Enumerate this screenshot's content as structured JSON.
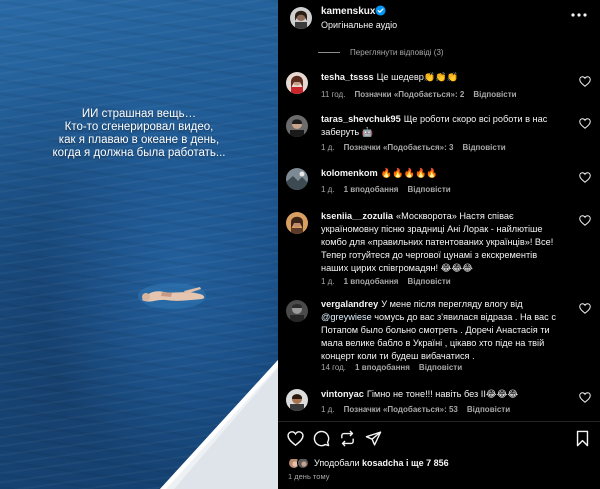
{
  "media": {
    "caption": "ИИ страшная вещь…\nКто-то сгенерировал видео,\nкак я плаваю в океане в день,\nкогда я должна была работать..."
  },
  "header": {
    "username": "kamenskux",
    "audio": "Оригінальне аудіо",
    "more_icon": "more-horizontal-icon"
  },
  "replies_toggle": "Переглянути відповіді (3)",
  "comments": [
    {
      "user": "tesha_tssss",
      "text": "Це шедевр👏👏👏",
      "time": "11 год.",
      "likes": "Позначки «Подобається»: 2",
      "reply": "Відповісти"
    },
    {
      "user": "taras_shevchuk95",
      "text": "Ще роботи скоро всі роботи в нас заберуть 🤖",
      "time": "1 д.",
      "likes": "Позначки «Подобається»: 3",
      "reply": "Відповісти"
    },
    {
      "user": "kolomenkom",
      "text": "🔥🔥🔥🔥🔥",
      "time": "1 д.",
      "likes": "1 вподобання",
      "reply": "Відповісти"
    },
    {
      "user": "kseniia__zozulia",
      "text": "«Москворота» Настя співає україномовну пісню зрадниці Ані Лорак - найлютіше комбо для «правильних патентованих українців»! Все! Тепер готуйтеся до чергової цунамі з екскрементів наших цирих співгромадян! 😂😂😂",
      "time": "1 д.",
      "likes": "1 вподобання",
      "reply": "Відповісти"
    },
    {
      "user": "vergalandrey",
      "text_before": "У мене після перегляду влогу від",
      "mention": "@greywiese",
      "text_after": "чомусь до вас з'явилася відраза . На вас с Потапом было больно смотреть . Доречі Анастасія ти мала велике бабло в Україні , цікаво хто піде на твій концерт коли ти будеш вибачатися .",
      "time": "14 год.",
      "likes": "1 вподобання",
      "reply": "Відповісти"
    },
    {
      "user": "vintonyac",
      "text": "Гімно не тоне!!! навіть без ІІ😂😂😂",
      "time": "1 д.",
      "likes": "Позначки «Подобається»: 53",
      "reply": "Відповісти"
    }
  ],
  "actions": {
    "like_icon": "heart-icon",
    "comment_icon": "comment-icon",
    "repost_icon": "repost-icon",
    "share_icon": "share-icon",
    "save_icon": "bookmark-icon"
  },
  "liked_by": {
    "prefix": "Уподобали",
    "user": "kosadcha",
    "suffix": "і ще 7 856"
  },
  "posted": "1 день тому"
}
